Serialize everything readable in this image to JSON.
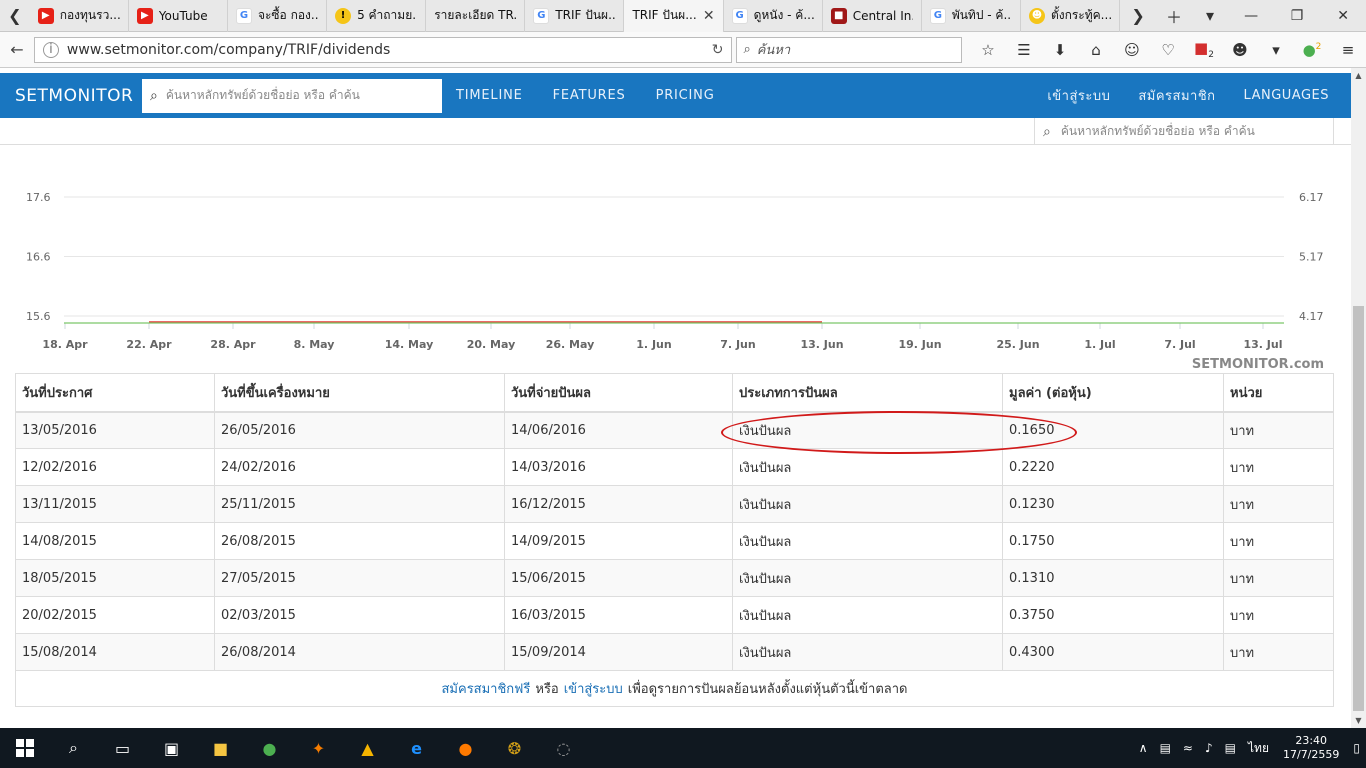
{
  "browser": {
    "tabs": [
      {
        "title": "กองทุนรว...",
        "icon": "youtube-icon"
      },
      {
        "title": "YouTube",
        "icon": "youtube-icon"
      },
      {
        "title": "จะซื้อ กอง...",
        "icon": "google-icon"
      },
      {
        "title": "5 คำถามย...",
        "icon": "yellow-circle-icon"
      },
      {
        "title": "รายละเอียด TR...",
        "icon": ""
      },
      {
        "title": "TRIF ปันผ...",
        "icon": "google-icon"
      },
      {
        "title": "TRIF ปันผ...",
        "icon": "",
        "active": true
      },
      {
        "title": "ดูหนัง - ค้...",
        "icon": "google-icon"
      },
      {
        "title": "Central In...",
        "icon": "central-icon"
      },
      {
        "title": "พันทิป - ค้...",
        "icon": "google-icon"
      },
      {
        "title": "ตั้งกระทู้ค...",
        "icon": "smiley-icon"
      }
    ],
    "url": "www.setmonitor.com/company/TRIF/dividends",
    "search_placeholder": "ค้นหา",
    "badge_pdf": "2",
    "badge_ext": "2"
  },
  "site": {
    "brand": "SETMONITOR",
    "search_placeholder": "ค้นหาหลักทรัพย์ด้วยชื่อย่อ หรือ คำค้น",
    "nav": [
      "TIMELINE",
      "FEATURES",
      "PRICING"
    ],
    "nav_right": [
      "เข้าสู่ระบบ",
      "สมัครสมาชิก",
      "LANGUAGES"
    ],
    "sub_search_placeholder": "ค้นหาหลักทรัพย์ด้วยชื่อย่อ หรือ คำค้น"
  },
  "chart_data": {
    "type": "line",
    "x_ticks": [
      "18. Apr",
      "22. Apr",
      "28. Apr",
      "8. May",
      "14. May",
      "20. May",
      "26. May",
      "1. Jun",
      "7. Jun",
      "13. Jun",
      "19. Jun",
      "25. Jun",
      "1. Jul",
      "7. Jul",
      "13. Jul"
    ],
    "y_left_ticks": [
      "17.6",
      "16.6",
      "15.6"
    ],
    "y_right_ticks": [
      "6.17",
      "5.17",
      "4.17"
    ],
    "series": [
      {
        "color": "#e53935",
        "x_range": [
          "22. Apr",
          "13. Jun"
        ],
        "y_left": 15.6
      },
      {
        "color": "#7cc86a",
        "x_range": [
          "18. Apr",
          "13. Jul"
        ],
        "y_left": 15.6
      }
    ],
    "watermark": "SETMONITOR.com"
  },
  "table": {
    "headers": [
      "วันที่ประกาศ",
      "วันที่ขึ้นเครื่องหมาย",
      "วันที่จ่ายปันผล",
      "ประเภทการปันผล",
      "มูลค่า (ต่อหุ้น)",
      "หน่วย"
    ],
    "rows": [
      [
        "13/05/2016",
        "26/05/2016",
        "14/06/2016",
        "เงินปันผล",
        "0.1650",
        "บาท"
      ],
      [
        "12/02/2016",
        "24/02/2016",
        "14/03/2016",
        "เงินปันผล",
        "0.2220",
        "บาท"
      ],
      [
        "13/11/2015",
        "25/11/2015",
        "16/12/2015",
        "เงินปันผล",
        "0.1230",
        "บาท"
      ],
      [
        "14/08/2015",
        "26/08/2015",
        "14/09/2015",
        "เงินปันผล",
        "0.1750",
        "บาท"
      ],
      [
        "18/05/2015",
        "27/05/2015",
        "15/06/2015",
        "เงินปันผล",
        "0.1310",
        "บาท"
      ],
      [
        "20/02/2015",
        "02/03/2015",
        "16/03/2015",
        "เงินปันผล",
        "0.3750",
        "บาท"
      ],
      [
        "15/08/2014",
        "26/08/2014",
        "15/09/2014",
        "เงินปันผล",
        "0.4300",
        "บาท"
      ]
    ]
  },
  "footer": {
    "signup": "สมัครสมาชิกฟรี",
    "or": "หรือ",
    "login": "เข้าสู่ระบบ",
    "rest": "เพื่อดูรายการปันผลย้อนหลังตั้งแต่หุ้นตัวนี้เข้าตลาด"
  },
  "taskbar": {
    "lang": "ไทย",
    "time": "23:40",
    "date": "17/7/2559"
  }
}
